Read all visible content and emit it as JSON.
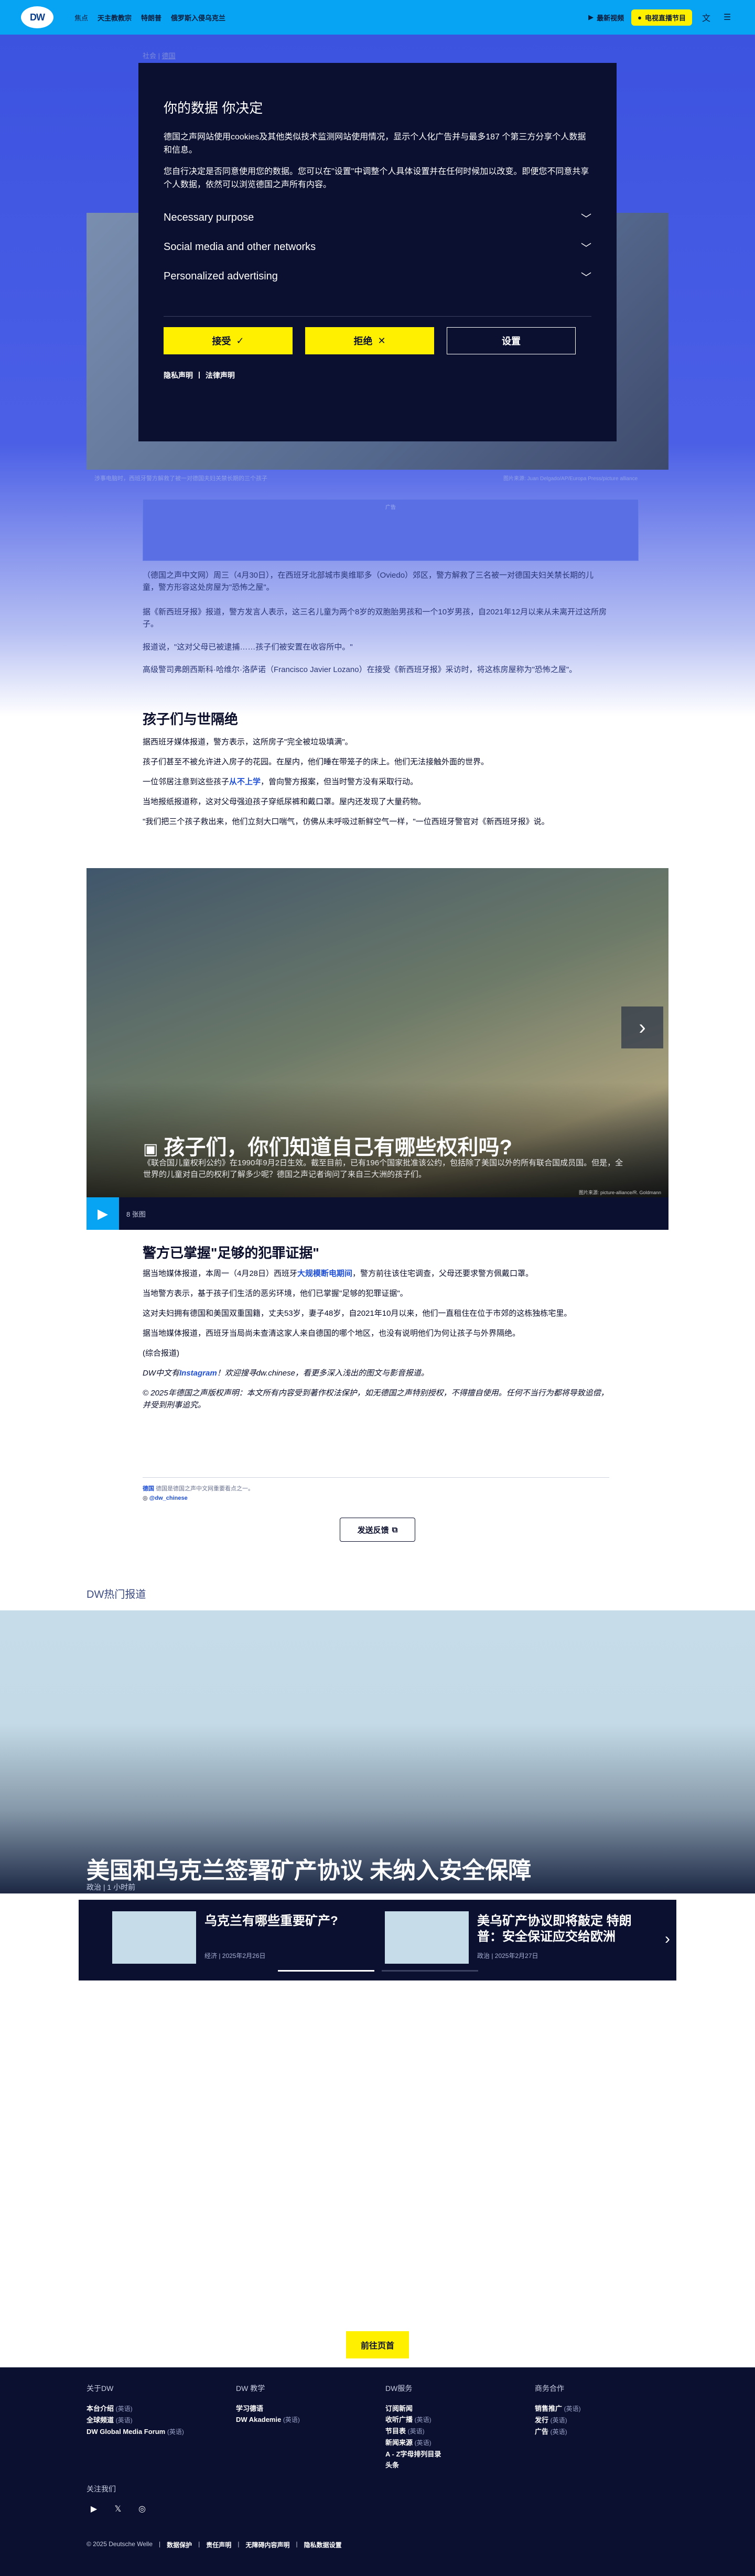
{
  "header": {
    "logo": "DW",
    "nav": [
      "焦点",
      "天主教教宗",
      "特朗普",
      "俄罗斯入侵乌克兰"
    ],
    "video_label": "最新视频",
    "live_label": "电视直播节目"
  },
  "background": {
    "breadcrumb_prefix": "社会 |",
    "breadcrumb_link": "德国",
    "hero_caption": "涉事电脑时，西班牙警方解救了被一对德国夫妇关禁长期的三个孩子",
    "hero_credit": "图片来源: Juan Delgado/AP/Europa Press/picture alliance",
    "ad_label": "广告",
    "paras": [
      "（德国之声中文网）周三（4月30日），在西班牙北部城市奥维耶多（Oviedo）郊区，警方解救了三名被一对德国夫妇关禁长期的儿童，警方形容这处房屋为\"恐怖之屋\"。",
      "据《新西班牙报》报道，警方发言人表示，这三名儿童为两个8岁的双胞胎男孩和一个10岁男孩，自2021年12月以来从未离开过这所房子。",
      "报道说，\"这对父母已被逮捕……孩子们被安置在收容所中。\"",
      "高级警司弗朗西斯科·哈维尔·洛萨诺（Francisco Javier Lozano）在接受《新西班牙报》采访时，将这栋房屋称为\"恐怖之屋\"。"
    ]
  },
  "consent": {
    "title": "你的数据 你决定",
    "p1": "德国之声网站使用cookies及其他类似技术监测网站使用情况，显示个人化广告并与最多187 个第三方分享个人数据和信息。",
    "p2": "您自行决定是否同意使用您的数据。您可以在\"设置\"中调整个人具体设置并在任何时候加以改变。即便您不同意共享个人数据，依然可以浏览德国之声所有内容。",
    "sections": [
      "Necessary purpose",
      "Social media and other networks",
      "Personalized advertising"
    ],
    "accept": "接受",
    "reject": "拒绝",
    "settings": "设置",
    "privacy": "隐私声明",
    "legal": "法律声明"
  },
  "article": {
    "h1": "孩子们与世隔绝",
    "s1": [
      "据西班牙媒体报道，警方表示，这所房子\"完全被垃圾填满\"。",
      "孩子们甚至不被允许进入房子的花园。在屋内，他们睡在带笼子的床上。他们无法接触外面的世界。",
      "一位邻居注意到这些孩子从不上学，曾向警方报案，但当时警方没有采取行动。",
      "当地报纸报道称，这对父母强迫孩子穿纸尿裤和戴口罩。屋内还发现了大量药物。",
      "\"我们把三个孩子救出来，他们立刻大口喘气，仿佛从未呼吸过新鲜空气一样，\"一位西班牙警官对《新西班牙报》说。"
    ],
    "s1_link": "从不上学",
    "gallery_title": "孩子们，你们知道自己有哪些权利吗?",
    "gallery_desc": "《联合国儿童权利公约》在1990年9月2日生效。截至目前，已有196个国家批准该公约，包括除了美国以外的所有联合国成员国。但是，全世界的儿童对自己的权利了解多少呢？德国之声记者询问了来自三大洲的孩子们。",
    "gallery_credit": "图片来源: picture-alliance/R. Goldmann",
    "gallery_count": "8 张图",
    "h2": "警方已掌握\"足够的犯罪证据\"",
    "s2_1": "据当地媒体报道，本周一（4月28日）西班牙大规模断电期间，警方前往该住宅调查，父母还要求警方佩戴口罩。",
    "s2_1_link": "大规模断电期间",
    "s2": [
      "当地警方表示，基于孩子们生活的恶劣环境，他们已掌握\"足够的犯罪证据\"。",
      "这对夫妇拥有德国和美国双重国籍，丈夫53岁，妻子48岁，自2021年10月以来，他们一直租住在位于市郊的这栋独栋宅里。",
      "据当地媒体报道，西班牙当局尚未查清这家人来自德国的哪个地区，也没有说明他们为何让孩子与外界隔绝。",
      "(综合报道)"
    ],
    "promo": "DW中文有Instagram！欢迎搜寻dw.chinese，看更多深入浅出的图文与影音报道。",
    "promo_link": "Instagram",
    "copyright": "© 2025年德国之声版权声明：本文所有内容受到著作权法保护，如无德国之声特别授权，不得擅自使用。任何不当行为都将导致追偿，并受到刑事追究。",
    "ig_name": "德国",
    "ig_desc": "德国是德国之声中文网重要看点之一。",
    "ig_handle": "@dw_chinese",
    "feedback": "发送反馈"
  },
  "hot": {
    "label": "DW热门报道",
    "title": "美国和乌克兰签署矿产协议 未纳入安全保障",
    "meta": "政治 | 1 小时前",
    "cards": [
      {
        "title": "乌克兰有哪些重要矿产?",
        "meta": "经济 | 2025年2月26日"
      },
      {
        "title": "美乌矿产协议即将敲定 特朗普：安全保证应交给欧洲",
        "meta": "政治 | 2025年2月27日"
      }
    ]
  },
  "to_top": "前往页首",
  "footer": {
    "cols": [
      {
        "title": "关于DW",
        "items": [
          {
            "label": "本台介绍",
            "note": "英语"
          },
          {
            "label": "全球频道",
            "note": "英语"
          },
          {
            "label": "DW Global Media Forum",
            "note": "英语"
          }
        ]
      },
      {
        "title": "DW 教学",
        "items": [
          {
            "label": "学习德语",
            "note": ""
          },
          {
            "label": "DW Akademie",
            "note": "英语"
          }
        ]
      },
      {
        "title": "DW服务",
        "items": [
          {
            "label": "订阅新闻",
            "note": ""
          },
          {
            "label": "收听广播",
            "note": "英语"
          },
          {
            "label": "节目表",
            "note": "英语"
          },
          {
            "label": "新闻来源",
            "note": "英语"
          },
          {
            "label": "A - Z字母排列目录",
            "note": ""
          },
          {
            "label": "头条",
            "note": ""
          }
        ]
      },
      {
        "title": "商务合作",
        "items": [
          {
            "label": "销售推广",
            "note": "英语"
          },
          {
            "label": "发行",
            "note": "英语"
          },
          {
            "label": "广告",
            "note": "英语"
          }
        ]
      }
    ],
    "follow": "关注我们",
    "copyright": "© 2025 Deutsche Welle",
    "links": [
      "数据保护",
      "责任声明",
      "无障碍内容声明",
      "隐私数据设置"
    ]
  }
}
